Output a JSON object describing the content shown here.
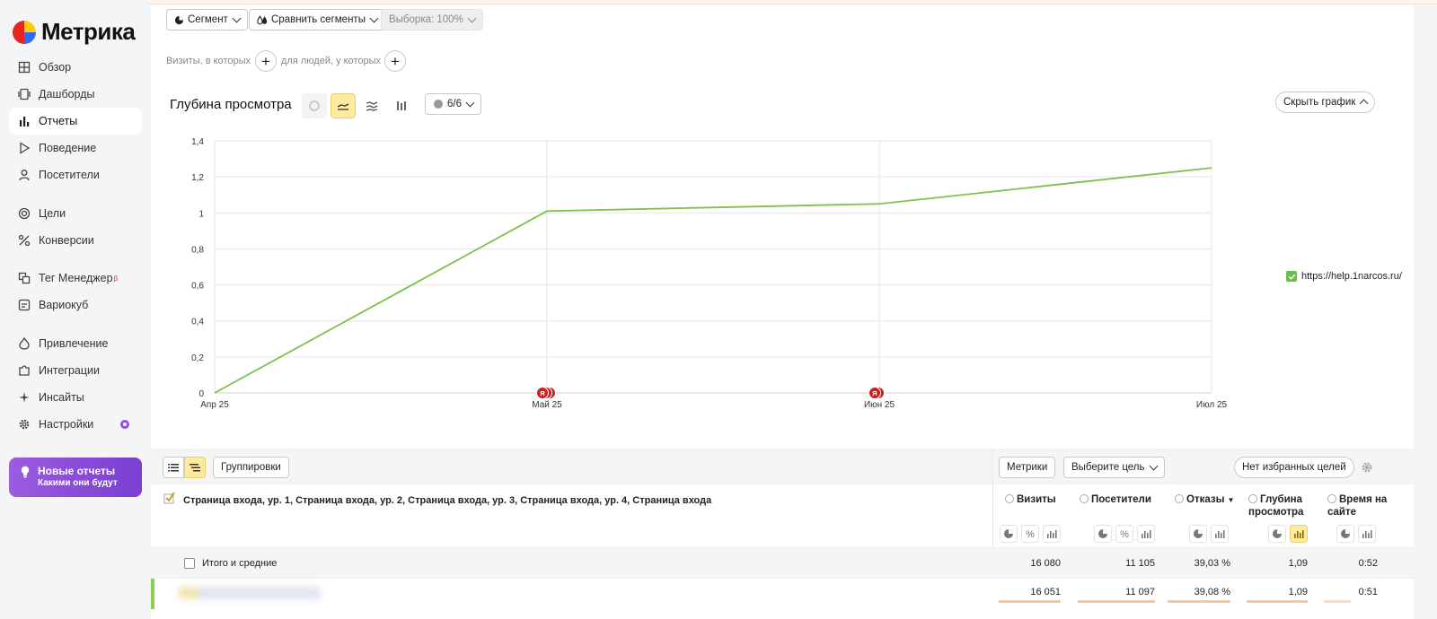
{
  "app": {
    "logo_text": "Метрика"
  },
  "sidebar": {
    "items": [
      {
        "label": "Обзор",
        "icon": "grid-icon"
      },
      {
        "label": "Дашборды",
        "icon": "dashboard-icon"
      },
      {
        "label": "Отчеты",
        "icon": "bar-chart-icon",
        "active": true
      },
      {
        "label": "Поведение",
        "icon": "play-icon"
      },
      {
        "label": "Посетители",
        "icon": "user-icon"
      },
      {
        "label": "Цели",
        "icon": "target-icon"
      },
      {
        "label": "Конверсии",
        "icon": "percent-icon"
      },
      {
        "label": "Тег Менеджер",
        "icon": "tag-manager-icon",
        "badge": "β"
      },
      {
        "label": "Вариокуб",
        "icon": "variocube-icon"
      },
      {
        "label": "Привлечение",
        "icon": "flame-icon"
      },
      {
        "label": "Интеграции",
        "icon": "puzzle-icon"
      },
      {
        "label": "Инсайты",
        "icon": "sparkle-icon"
      },
      {
        "label": "Настройки",
        "icon": "gear-icon"
      }
    ],
    "promo": {
      "title": "Новые отчеты",
      "subtitle": "Какими они будут"
    }
  },
  "toolbar": {
    "segment_label": "Сегмент",
    "compare_label": "Сравнить сегменты",
    "sample_label": "Выборка: 100%"
  },
  "filters": {
    "visits_label": "Визиты, в которых",
    "people_label": "для людей, у которых"
  },
  "chart_header": {
    "title": "Глубина просмотра",
    "series_count": "6/6",
    "hide_chart_label": "Скрыть график"
  },
  "chart_data": {
    "type": "line",
    "x": [
      "Апр 25",
      "Май 25",
      "Июн 25",
      "Июл 25"
    ],
    "series": [
      {
        "name": "https://help.1narcos.ru/",
        "values": [
          0,
          1.01,
          1.05,
          1.25
        ],
        "color": "#7dc24a"
      }
    ],
    "ylim": [
      0,
      1.4
    ],
    "yticks": [
      "0",
      "0,2",
      "0,4",
      "0,6",
      "0,8",
      "1",
      "1,2",
      "1,4"
    ],
    "grid": true,
    "legend": "right",
    "annotation_marker": "Я"
  },
  "table": {
    "groupings_label": "Группировки",
    "metrics_label": "Метрики",
    "goal_label": "Выберите цель",
    "favorites_label": "Нет избранных целей",
    "dimensions_title": "Страница входа, ур. 1, Страница входа, ур. 2, Страница входа, ур. 3, Страница входа, ур. 4, Страница входа",
    "columns": [
      {
        "label": "Визиты"
      },
      {
        "label": "Посетители"
      },
      {
        "label": "Отказы",
        "sort": "▼"
      },
      {
        "label": "Глубина просмотра"
      },
      {
        "label": "Время на сайте"
      }
    ],
    "total_label": "Итого и средние",
    "total": [
      "16 080",
      "11 105",
      "39,03 %",
      "1,09",
      "0:52"
    ],
    "rows": [
      {
        "values": [
          "16 051",
          "11 097",
          "39,08 %",
          "1,09",
          "0:51"
        ]
      }
    ]
  },
  "colors": {
    "accent": "#ffeba0",
    "line": "#7dc24a",
    "promo": "#8a4ad9"
  }
}
